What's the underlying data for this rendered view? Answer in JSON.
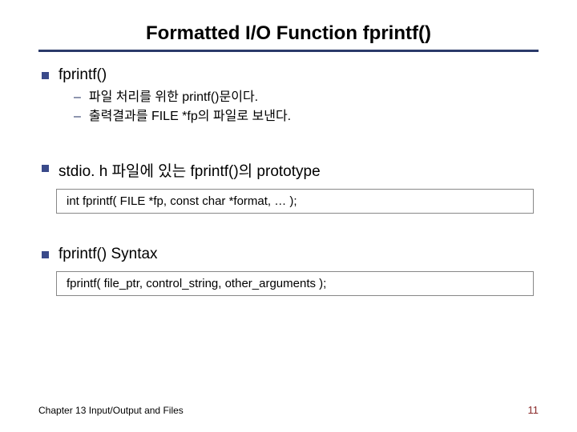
{
  "title": "Formatted I/O Function fprintf()",
  "section1": {
    "heading": "fprintf()",
    "sub1": "파일 처리를 위한 printf()문이다.",
    "sub2": "출력결과를 FILE *fp의 파일로 보낸다."
  },
  "section2": {
    "heading": "stdio. h 파일에 있는 fprintf()의 prototype",
    "code": "int fprintf( FILE *fp, const char *format, … );"
  },
  "section3": {
    "heading": "fprintf() Syntax",
    "code": "fprintf( file_ptr, control_string, other_arguments );"
  },
  "footer": {
    "chapter": "Chapter 13  Input/Output and Files",
    "page": "11"
  }
}
